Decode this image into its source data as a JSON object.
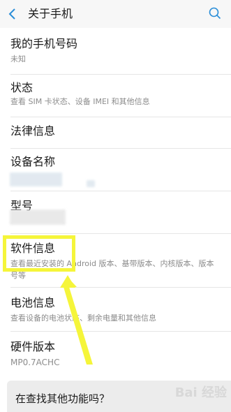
{
  "header": {
    "title": "关于手机"
  },
  "items": [
    {
      "title": "我的手机号码",
      "subtitle": "未知"
    },
    {
      "title": "状态",
      "subtitle": "查看 SIM 卡状态、设备 IMEI 和其他信息"
    },
    {
      "title": "法律信息"
    },
    {
      "title": "设备名称"
    },
    {
      "title": "型号"
    },
    {
      "title": "软件信息",
      "subtitle": "查看最近安装的 Android 版本、基带版本、内核版本、版本号等"
    },
    {
      "title": "电池信息",
      "subtitle": "查看设备的电池状态、剩余电量和其他信息"
    },
    {
      "title": "硬件版本",
      "subtitle": "MP0.7ACHC"
    }
  ],
  "bottom": {
    "prompt": "在查找其他功能吗？"
  },
  "watermark": "Bai 经验",
  "colors": {
    "accent": "#2a8ed8",
    "highlight": "#f5f53a"
  }
}
